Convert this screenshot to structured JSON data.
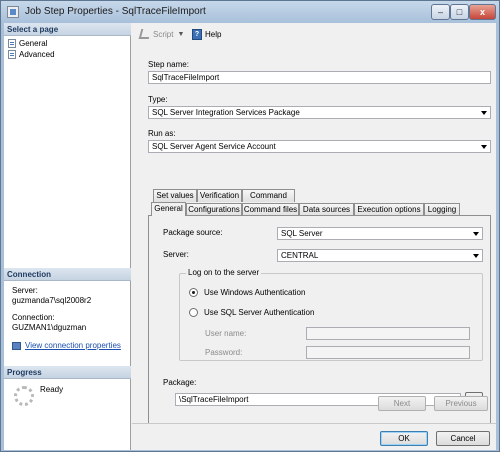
{
  "window": {
    "title": "Job Step Properties - SqlTraceFileImport",
    "min": "–",
    "max": "□",
    "close": "x"
  },
  "left": {
    "select_page_header": "Select a page",
    "pages": [
      {
        "label": "General"
      },
      {
        "label": "Advanced"
      }
    ],
    "connection_header": "Connection",
    "server_label": "Server:",
    "server_value": "guzmanda7\\sql2008r2",
    "connection_label": "Connection:",
    "connection_value": "GUZMAN1\\dguzman",
    "view_props_link": "View connection properties",
    "progress_header": "Progress",
    "progress_status": "Ready"
  },
  "toolbar": {
    "script_label": "Script",
    "help_label": "Help"
  },
  "form": {
    "step_name_label": "Step name:",
    "step_name_value": "SqlTraceFileImport",
    "type_label": "Type:",
    "type_value": "SQL Server Integration Services Package",
    "run_as_label": "Run as:",
    "run_as_value": "SQL Server Agent Service Account"
  },
  "tabs": {
    "row_back": [
      "Set values",
      "Verification",
      "Command line"
    ],
    "row_front": [
      "General",
      "Configurations",
      "Command files",
      "Data sources",
      "Execution options",
      "Logging"
    ],
    "active": "General"
  },
  "general": {
    "package_source_label": "Package source:",
    "package_source_value": "SQL Server",
    "server_label": "Server:",
    "server_value": "CENTRAL",
    "logon_group_title": "Log on to the server",
    "windows_auth_label": "Use Windows Authentication",
    "sql_auth_label": "Use SQL Server Authentication",
    "auth_selected": "windows",
    "username_label": "User name:",
    "password_label": "Password:",
    "package_label": "Package:",
    "package_value": "\\SqlTraceFileImport",
    "browse_label": "..."
  },
  "buttons": {
    "next": "Next",
    "previous": "Previous",
    "ok": "OK",
    "cancel": "Cancel"
  },
  "colors": {
    "accent": "#3c7fb1",
    "link": "#1c4fb0",
    "header_bg": "#c5d3e2"
  },
  "icons": {
    "page": "page-icon",
    "script": "script-icon",
    "help": "help-icon",
    "link": "connection-properties-icon"
  }
}
